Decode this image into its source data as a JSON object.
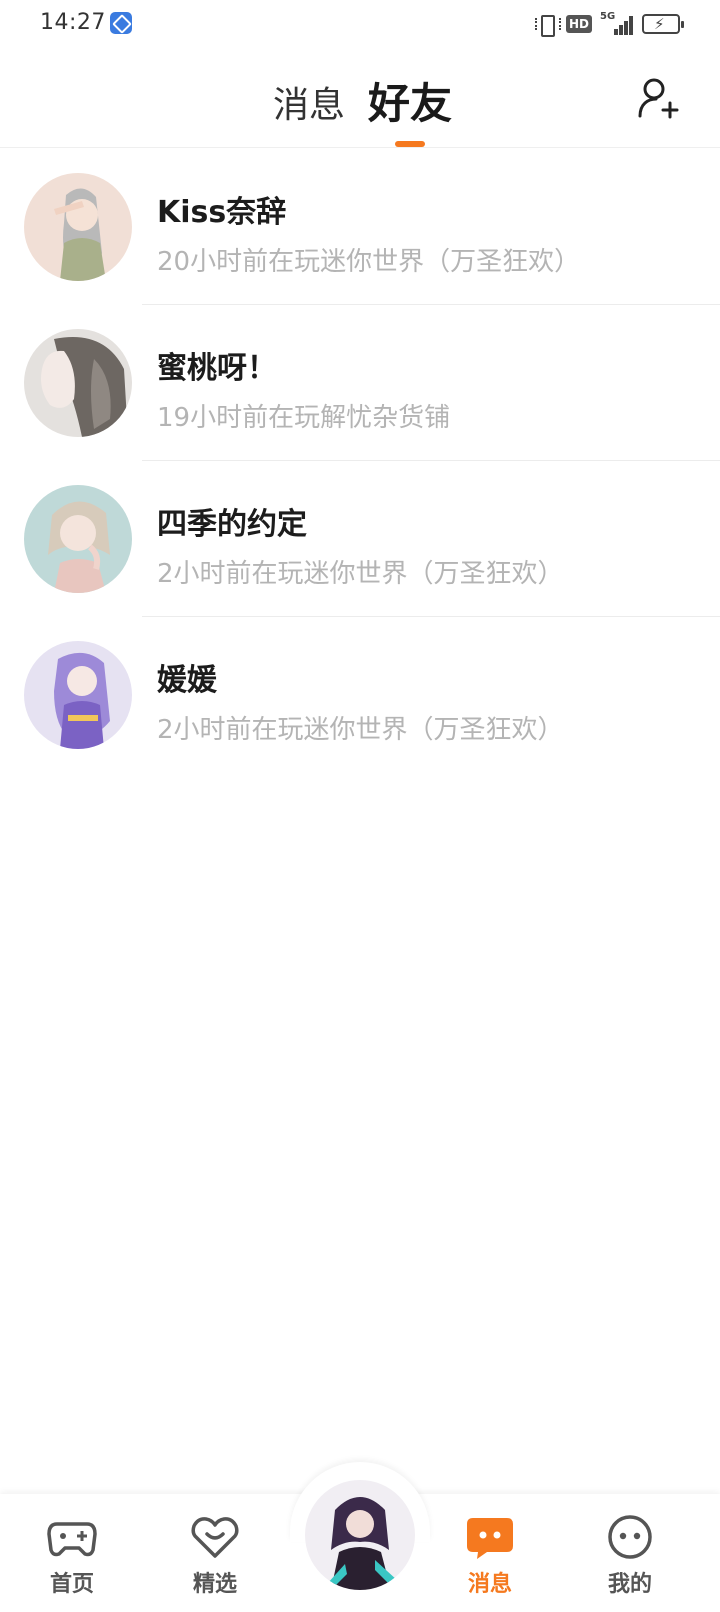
{
  "status_bar": {
    "time": "14:27",
    "hd": "HD",
    "network": "5G"
  },
  "header": {
    "tab_messages": "消息",
    "tab_friends": "好友",
    "active_tab": "好友",
    "add_friend_icon": "add-friend-icon",
    "accent": "#f5791f"
  },
  "friends": [
    {
      "name": "Kiss奈辞",
      "status": "20小时前在玩迷你世界（万圣狂欢）",
      "avatar_bg": "#f1dfd6"
    },
    {
      "name": "蜜桃呀！",
      "status": "19小时前在玩解忧杂货铺",
      "avatar_bg": "#e4e1de"
    },
    {
      "name": "四季的约定",
      "status": "2小时前在玩迷你世界（万圣狂欢）",
      "avatar_bg": "#bfd9d8"
    },
    {
      "name": "媛媛",
      "status": "2小时前在玩迷你世界（万圣狂欢）",
      "avatar_bg": "#e6e2f2"
    }
  ],
  "bottom_nav": {
    "items": [
      {
        "label": "首页",
        "icon": "gamepad-icon",
        "active": false
      },
      {
        "label": "精选",
        "icon": "heart-icon",
        "active": false
      },
      {
        "label": "消息",
        "icon": "chat-bubble-icon",
        "active": true
      },
      {
        "label": "我的",
        "icon": "smiley-icon",
        "active": false
      }
    ],
    "center_icon": "character-avatar-icon"
  }
}
